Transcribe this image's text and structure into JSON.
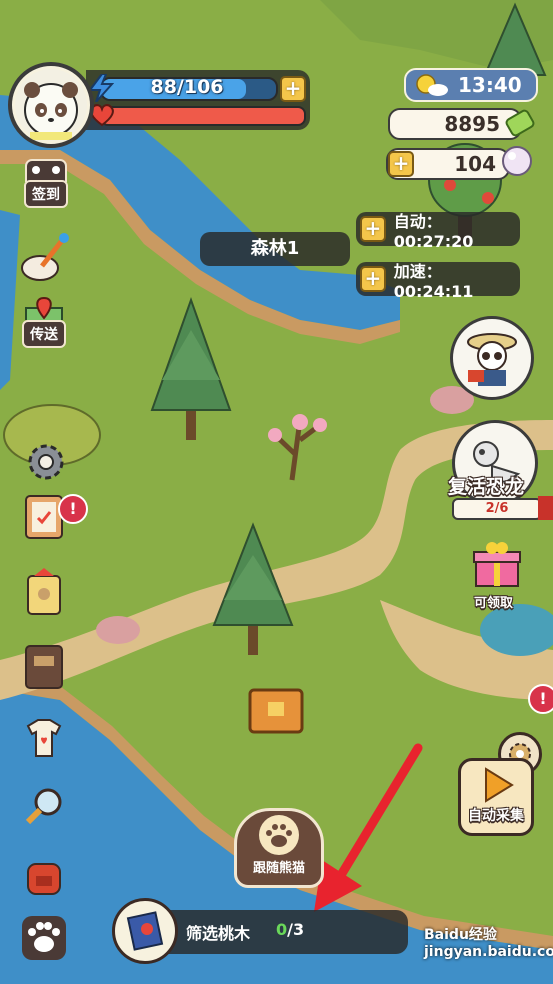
{
  "player": {
    "energy_text": "88/106",
    "energy_fraction": 0.83,
    "hp_fraction": 1.0
  },
  "topright": {
    "clock": "13:40",
    "coins": "8895",
    "gems": "104"
  },
  "left_menu": {
    "checkin_label": "签到",
    "teleport_label": "传送"
  },
  "location": "森林1",
  "timers": {
    "auto_text": "自动：00:27:20",
    "speed_text": "加速：00:24:11"
  },
  "right_panel": {
    "revive_label": "复活恐龙",
    "revive_progress": "2/6",
    "gift_label": "可领取",
    "auto_collect_label": "自动采集"
  },
  "follow_label": "跟随熊猫",
  "quest": {
    "name": "筛选桃木",
    "count_done": "0",
    "count_total": "/3"
  },
  "badges": {
    "exclaim": "!"
  },
  "watermark": "Baidu经验 jingyan.baidu.com",
  "colors": {
    "grass": "#8aae46",
    "river": "#3f8fc8",
    "path": "#dcc08a",
    "energy": "#4aa3e8",
    "hp": "#ef5a4a",
    "accent_gold": "#f4c64a",
    "arrow_red": "#e8232e"
  },
  "icons": [
    "lightning-icon",
    "heart-icon",
    "plus-icon",
    "sun-cloud-icon",
    "candy-icon",
    "pearl-icon",
    "panda-calendar-icon",
    "wand-toys-icon",
    "map-pin-icon",
    "gear-icon",
    "notebook-icon",
    "gift-tag-icon",
    "book-icon",
    "shirt-icon",
    "magnifier-icon",
    "backpack-icon",
    "paw-icon",
    "play-icon"
  ]
}
